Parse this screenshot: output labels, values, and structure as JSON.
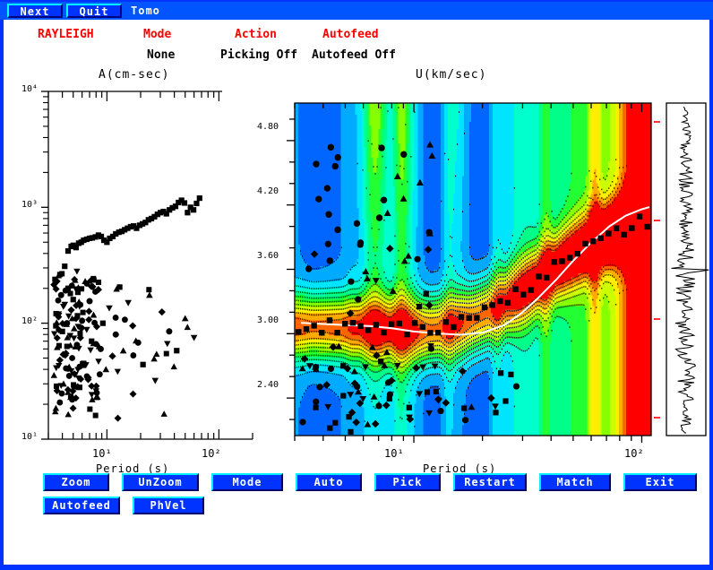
{
  "window": {
    "frame_color": "#0033ff",
    "canvas_bg": "#ffffff"
  },
  "menubar": {
    "items": [
      {
        "label": "Next",
        "name": "menu-next",
        "type": "button"
      },
      {
        "label": "Quit",
        "name": "menu-quit",
        "type": "button"
      },
      {
        "label": "Tomo",
        "name": "menu-tomo",
        "type": "text"
      }
    ]
  },
  "header": {
    "wave_type": "RAYLEIGH",
    "col_mode_title": "Mode",
    "col_mode_value": "None",
    "col_action_title": "Action",
    "col_action_value": "Picking Off",
    "col_autofeed_title": "Autofeed",
    "col_autofeed_value": "Autofeed Off",
    "title_color": "#ff0000",
    "value_color": "#000000"
  },
  "left_plot": {
    "title": "A(cm-sec)",
    "xlabel": "Period (s)",
    "x_ticklabels": [
      "10¹",
      "10²"
    ],
    "y_ticklabels": [
      "10⁴",
      "10³",
      "10²",
      "10¹"
    ]
  },
  "right_plot": {
    "title": "U(km/sec)",
    "xlabel": "Period (s)",
    "x_ticklabels": [
      "10¹",
      "10²"
    ],
    "y_ticklabels": [
      "4.80",
      "4.20",
      "3.60",
      "3.00",
      "2.40"
    ],
    "curve_color": "#ffffff",
    "marker_color": "#000000"
  },
  "seismogram": {
    "trace_color": "#000000",
    "tick_color": "#ff0000",
    "border_color": "#000000"
  },
  "buttons": {
    "row1": [
      {
        "label": "Zoom",
        "name": "zoom-button"
      },
      {
        "label": "UnZoom",
        "name": "unzoom-button"
      },
      {
        "label": "Mode",
        "name": "mode-button"
      },
      {
        "label": "Auto",
        "name": "auto-button"
      },
      {
        "label": "Pick",
        "name": "pick-button"
      },
      {
        "label": "Restart",
        "name": "restart-button"
      },
      {
        "label": "Match",
        "name": "match-button"
      },
      {
        "label": "Exit",
        "name": "exit-button"
      }
    ],
    "row2": [
      {
        "label": "Autofeed",
        "name": "autofeed-button"
      },
      {
        "label": "PhVel",
        "name": "phvel-button"
      }
    ],
    "face_color": "#0033ff",
    "highlight_color": "#00f0ff",
    "text_color": "#ffffff"
  },
  "chart_data": [
    {
      "type": "scatter",
      "id": "amplitude-spectrum",
      "title": "A(cm-sec)",
      "xlabel": "Period (s)",
      "ylabel": "A(cm-sec)",
      "xscale": "log",
      "yscale": "log",
      "xlim": [
        3.0,
        200.0
      ],
      "ylim": [
        10,
        10000
      ],
      "grid": false,
      "legend": "none",
      "series": [
        {
          "name": "upper-branch-squares",
          "marker": "square",
          "points": [
            [
              4.2,
              310
            ],
            [
              4.5,
              420
            ],
            [
              4.8,
              460
            ],
            [
              5.0,
              470
            ],
            [
              5.3,
              450
            ],
            [
              5.6,
              490
            ],
            [
              5.9,
              500
            ],
            [
              6.2,
              520
            ],
            [
              6.6,
              530
            ],
            [
              7.0,
              540
            ],
            [
              7.4,
              545
            ],
            [
              7.9,
              555
            ],
            [
              8.4,
              575
            ],
            [
              8.9,
              560
            ],
            [
              9.4,
              520
            ],
            [
              10.0,
              500
            ],
            [
              10.6,
              540
            ],
            [
              11.3,
              560
            ],
            [
              12.0,
              590
            ],
            [
              12.8,
              610
            ],
            [
              13.6,
              620
            ],
            [
              14.4,
              640
            ],
            [
              15.3,
              660
            ],
            [
              16.3,
              680
            ],
            [
              17.3,
              690
            ],
            [
              18.4,
              660
            ],
            [
              19.6,
              700
            ],
            [
              20.8,
              720
            ],
            [
              22.1,
              740
            ],
            [
              23.5,
              780
            ],
            [
              25.0,
              800
            ],
            [
              26.6,
              830
            ],
            [
              28.3,
              870
            ],
            [
              30.1,
              900
            ],
            [
              32.0,
              920
            ],
            [
              34.0,
              880
            ],
            [
              36.2,
              950
            ],
            [
              38.5,
              990
            ],
            [
              41.0,
              1020
            ],
            [
              43.6,
              1100
            ],
            [
              46.4,
              1150
            ],
            [
              49.3,
              1090
            ],
            [
              52.5,
              900
            ],
            [
              55.8,
              1000
            ],
            [
              59.4,
              950
            ],
            [
              63.2,
              1080
            ],
            [
              67.2,
              1200
            ]
          ]
        },
        {
          "name": "lower-cloud-mixed",
          "marker": "mixed",
          "points": [
            [
              3.5,
              95
            ],
            [
              3.6,
              62
            ],
            [
              3.7,
              120
            ],
            [
              3.8,
              48
            ],
            [
              3.9,
              175
            ],
            [
              4.0,
              85
            ],
            [
              4.1,
              30
            ],
            [
              4.2,
              145
            ],
            [
              4.3,
              55
            ],
            [
              4.4,
              100
            ],
            [
              4.5,
              200
            ],
            [
              4.6,
              42
            ],
            [
              4.7,
              78
            ],
            [
              4.8,
              130
            ],
            [
              4.9,
              22
            ],
            [
              5.0,
              160
            ],
            [
              5.1,
              90
            ],
            [
              5.2,
              36
            ],
            [
              5.3,
              110
            ],
            [
              5.4,
              65
            ],
            [
              5.5,
              185
            ],
            [
              5.6,
              28
            ],
            [
              5.7,
              140
            ],
            [
              5.8,
              75
            ],
            [
              6.0,
              105
            ],
            [
              6.2,
              45
            ],
            [
              6.4,
              230
            ],
            [
              6.6,
              88
            ],
            [
              6.8,
              34
            ],
            [
              7.0,
              155
            ],
            [
              7.3,
              70
            ],
            [
              7.6,
              118
            ],
            [
              8.0,
              26
            ],
            [
              8.4,
              195
            ],
            [
              8.8,
              60
            ],
            [
              9.2,
              100
            ],
            [
              9.8,
              40
            ],
            [
              10.5,
              135
            ],
            [
              11.2,
              52
            ],
            [
              12.0,
              80
            ],
            [
              13.0,
              205
            ],
            [
              14.0,
              58
            ],
            [
              15.5,
              150
            ],
            [
              17.0,
              95
            ],
            [
              19.0,
              68
            ],
            [
              21.0,
              44
            ],
            [
              24.0,
              175
            ],
            [
              27.0,
              32
            ],
            [
              31.0,
              125
            ],
            [
              36.0,
              85
            ],
            [
              42.0,
              58
            ],
            [
              50.0,
              110
            ],
            [
              60.0,
              75
            ]
          ]
        }
      ]
    },
    {
      "type": "heatmap",
      "id": "group-velocity-dispersion",
      "title": "U(km/sec)",
      "xlabel": "Period (s)",
      "ylabel": "U(km/sec)",
      "xscale": "log",
      "xlim": [
        3.0,
        110.0
      ],
      "ylim": [
        2.05,
        5.15
      ],
      "yticks": [
        2.4,
        3.0,
        3.6,
        4.2,
        4.8
      ],
      "xticks": [
        10,
        100
      ],
      "colormap": "rainbow",
      "colormap_stops": [
        "#0066ff",
        "#00aaff",
        "#00e5ff",
        "#00ffcc",
        "#00ff88",
        "#22ff33",
        "#88ff00",
        "#ccff00",
        "#ffee00",
        "#ffaa00",
        "#ff6600",
        "#ff0000"
      ],
      "overlays": [
        {
          "name": "dispersion-curve",
          "type": "line",
          "color": "#ffffff",
          "points": [
            [
              3.2,
              3.1
            ],
            [
              4.0,
              3.09
            ],
            [
              5.0,
              3.08
            ],
            [
              6.5,
              3.07
            ],
            [
              8.0,
              3.05
            ],
            [
              10.0,
              3.02
            ],
            [
              13.0,
              3.0
            ],
            [
              16.0,
              2.99
            ],
            [
              20.0,
              3.01
            ],
            [
              25.0,
              3.08
            ],
            [
              30.0,
              3.2
            ],
            [
              35.0,
              3.33
            ],
            [
              42.0,
              3.5
            ],
            [
              50.0,
              3.68
            ],
            [
              60.0,
              3.85
            ],
            [
              72.0,
              4.0
            ],
            [
              85.0,
              4.1
            ],
            [
              100.0,
              4.16
            ],
            [
              108.0,
              4.18
            ]
          ]
        },
        {
          "name": "picked-points",
          "type": "scatter",
          "color": "#000000",
          "marker": "mixed"
        }
      ]
    }
  ]
}
